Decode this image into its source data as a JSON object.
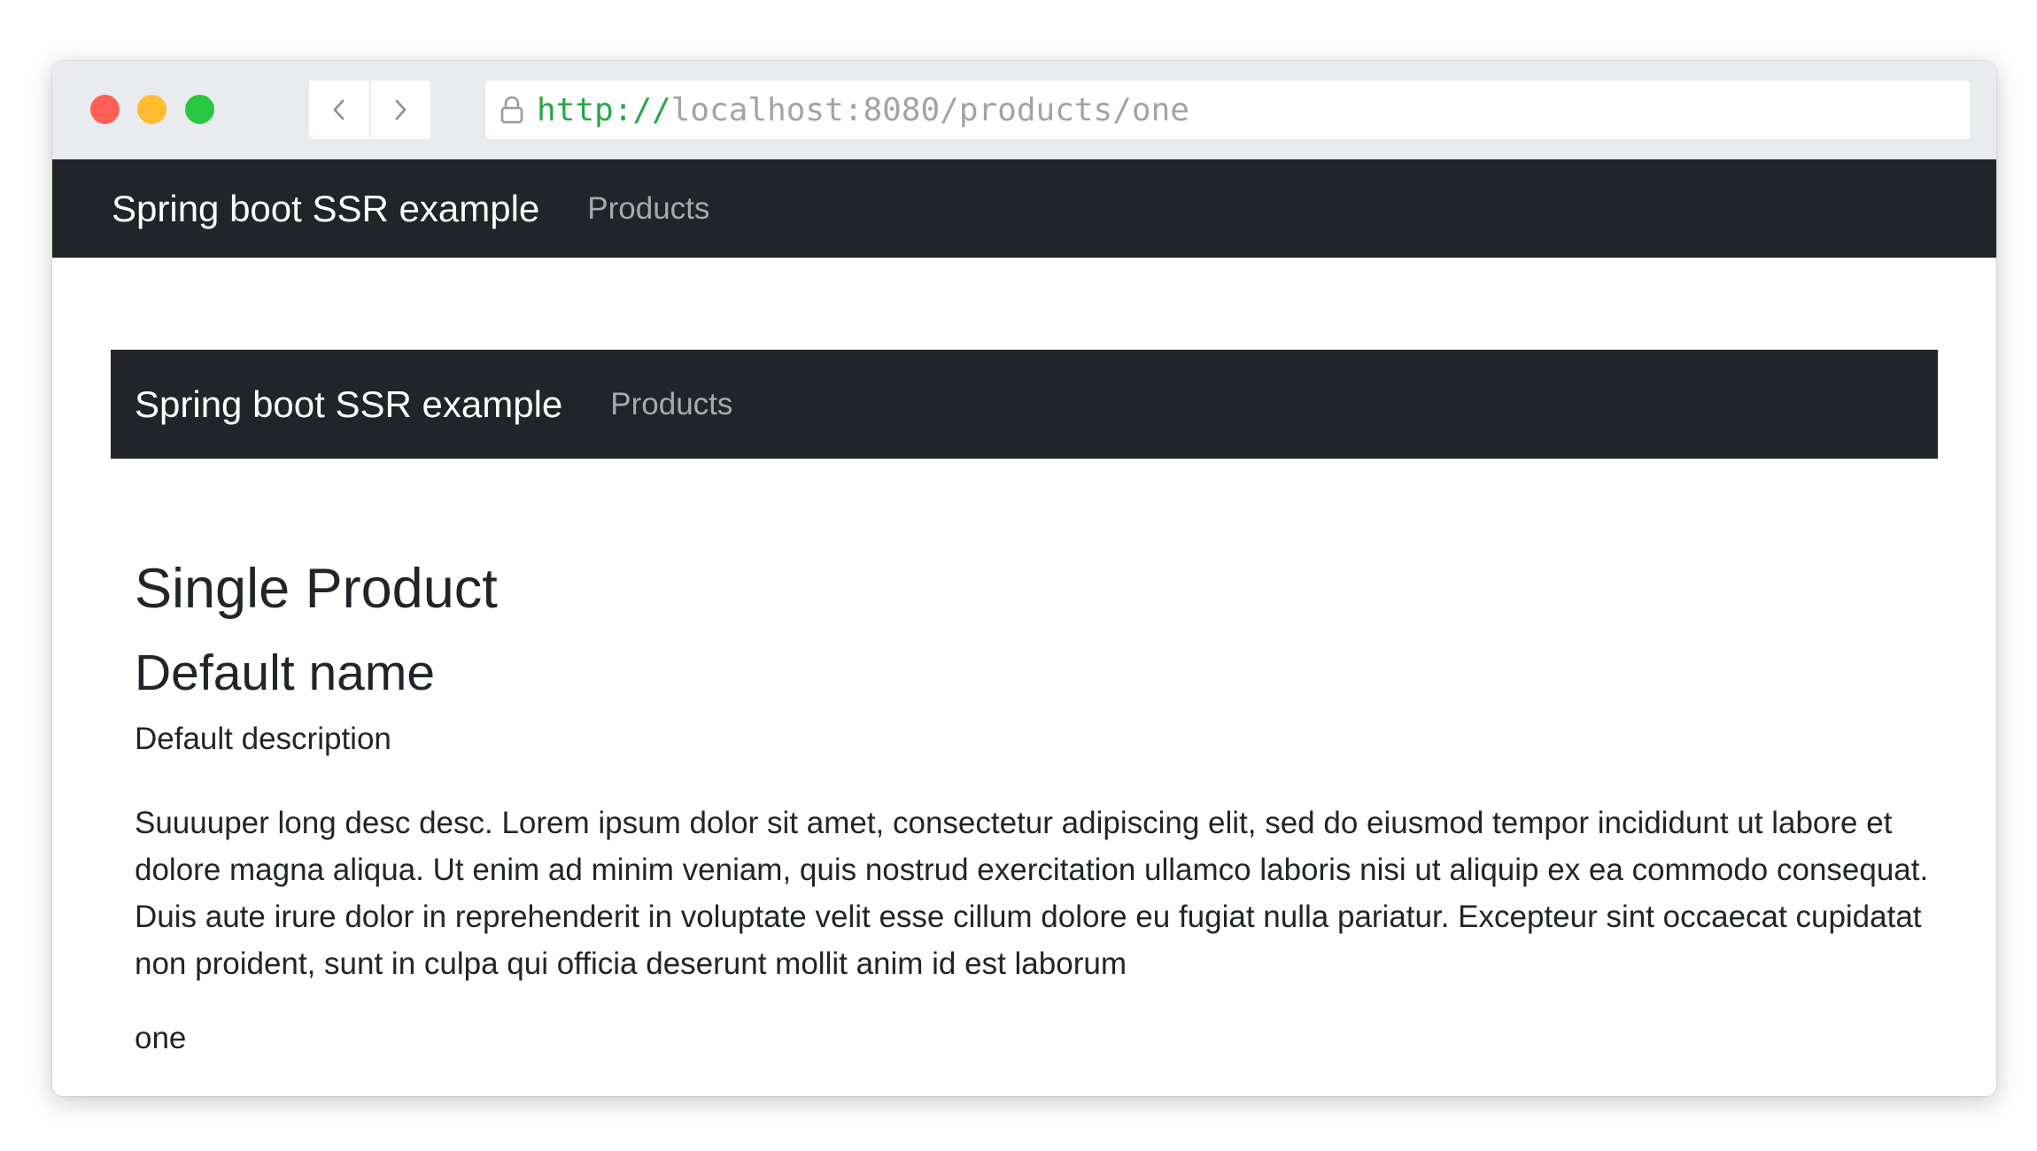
{
  "browser": {
    "url_scheme": "http://",
    "url_rest": "localhost:8080/products/one",
    "traffic_colors": {
      "close": "#ff5f57",
      "minimize": "#febc2e",
      "zoom": "#28c840"
    },
    "icons": {
      "back": "chevron-left-icon",
      "forward": "chevron-right-icon",
      "lock": "lock-icon"
    }
  },
  "navbar": {
    "brand": "Spring boot SSR example",
    "link": "Products",
    "background": "#212529"
  },
  "inner_navbar": {
    "brand": "Spring boot SSR example",
    "link": "Products"
  },
  "product": {
    "page_heading": "Single Product",
    "name": "Default name",
    "description": "Default description",
    "long_description": "Suuuuper long desc desc. Lorem ipsum dolor sit amet, consectetur adipiscing elit, sed do eiusmod tempor incididunt ut labore et dolore magna aliqua. Ut enim ad minim veniam, quis nostrud exercitation ullamco laboris nisi ut aliquip ex ea commodo consequat. Duis aute irure dolor in reprehenderit in voluptate velit esse cillum dolore eu fugiat nulla pariatur. Excepteur sint occaecat cupidatat non proident, sunt in culpa qui officia deserunt mollit anim id est laborum",
    "slug": "one"
  }
}
